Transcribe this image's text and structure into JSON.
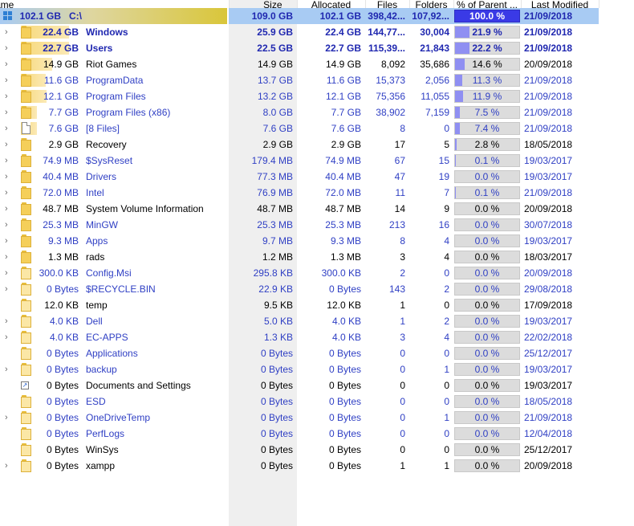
{
  "columns": {
    "name": "ame",
    "size": "Size",
    "allocated": "Allocated",
    "files": "Files",
    "folders": "Folders",
    "pct_parent": "% of Parent ...",
    "last_modified": "Last Modified"
  },
  "colors": {
    "root_row_bg": "#a8cbf3",
    "size_column_bg": "#efefef",
    "percent_bar": "#8f8ff2",
    "percent_bar_root": "#3a3ae6",
    "folder_yellow": "#f5cf5a",
    "bar_yellow": "#fbe9b6",
    "blue_text": "#2f3fc4"
  },
  "root": {
    "icon": "drive-icon",
    "tree_size": "102.1 GB",
    "name": "C:\\",
    "size": "109.0 GB",
    "allocated": "102.1 GB",
    "files": "398,42...",
    "folders": "107,92...",
    "pct": "100.0 %",
    "pct_value": 100,
    "modified": "21/09/2018"
  },
  "rows": [
    {
      "icon": "folder-icon",
      "expandable": true,
      "bar": 22.2,
      "style": "boldblue",
      "tree_size": "22.4 GB",
      "name": "Windows",
      "size": "25.9 GB",
      "allocated": "22.4 GB",
      "files": "144,77...",
      "folders": "30,004",
      "pct": "21.9 %",
      "pct_value": 21.9,
      "modified": "21/09/2018"
    },
    {
      "icon": "folder-icon",
      "expandable": true,
      "bar": 22.2,
      "style": "boldblue",
      "tree_size": "22.7 GB",
      "name": "Users",
      "size": "22.5 GB",
      "allocated": "22.7 GB",
      "files": "115,39...",
      "folders": "21,843",
      "pct": "22.2 %",
      "pct_value": 22.2,
      "modified": "21/09/2018"
    },
    {
      "icon": "folder-icon",
      "expandable": true,
      "bar": 14.6,
      "style": "black",
      "tree_size": "14.9 GB",
      "name": "Riot Games",
      "size": "14.9 GB",
      "allocated": "14.9 GB",
      "files": "8,092",
      "folders": "35,686",
      "pct": "14.6 %",
      "pct_value": 14.6,
      "modified": "20/09/2018"
    },
    {
      "icon": "folder-icon",
      "expandable": true,
      "bar": 11.3,
      "style": "blue",
      "tree_size": "11.6 GB",
      "name": "ProgramData",
      "size": "13.7 GB",
      "allocated": "11.6 GB",
      "files": "15,373",
      "folders": "2,056",
      "pct": "11.3 %",
      "pct_value": 11.3,
      "modified": "21/09/2018"
    },
    {
      "icon": "folder-icon",
      "expandable": true,
      "bar": 11.9,
      "style": "blue",
      "tree_size": "12.1 GB",
      "name": "Program Files",
      "size": "13.2 GB",
      "allocated": "12.1 GB",
      "files": "75,356",
      "folders": "11,055",
      "pct": "11.9 %",
      "pct_value": 11.9,
      "modified": "21/09/2018"
    },
    {
      "icon": "folder-icon",
      "expandable": true,
      "bar": 7.5,
      "style": "blue",
      "tree_size": "7.7 GB",
      "name": "Program Files (x86)",
      "size": "8.0 GB",
      "allocated": "7.7 GB",
      "files": "38,902",
      "folders": "7,159",
      "pct": "7.5 %",
      "pct_value": 7.5,
      "modified": "21/09/2018"
    },
    {
      "icon": "file-icon",
      "expandable": true,
      "bar": 7.4,
      "style": "blue",
      "tree_size": "7.6 GB",
      "name": "[8 Files]",
      "size": "7.6 GB",
      "allocated": "7.6 GB",
      "files": "8",
      "folders": "0",
      "pct": "7.4 %",
      "pct_value": 7.4,
      "modified": "21/09/2018"
    },
    {
      "icon": "folder-icon",
      "expandable": true,
      "bar": 2.8,
      "style": "black",
      "tree_size": "2.9 GB",
      "name": "Recovery",
      "size": "2.9 GB",
      "allocated": "2.9 GB",
      "files": "17",
      "folders": "5",
      "pct": "2.8 %",
      "pct_value": 2.8,
      "modified": "18/05/2018"
    },
    {
      "icon": "folder-icon",
      "expandable": true,
      "bar": 0.1,
      "style": "blue",
      "tree_size": "74.9 MB",
      "name": "$SysReset",
      "size": "179.4 MB",
      "allocated": "74.9 MB",
      "files": "67",
      "folders": "15",
      "pct": "0.1 %",
      "pct_value": 0.1,
      "modified": "19/03/2017"
    },
    {
      "icon": "folder-icon",
      "expandable": true,
      "bar": 0,
      "style": "blue",
      "tree_size": "40.4 MB",
      "name": "Drivers",
      "size": "77.3 MB",
      "allocated": "40.4 MB",
      "files": "47",
      "folders": "19",
      "pct": "0.0 %",
      "pct_value": 0,
      "modified": "19/03/2017"
    },
    {
      "icon": "folder-icon",
      "expandable": true,
      "bar": 0.1,
      "style": "blue",
      "tree_size": "72.0 MB",
      "name": "Intel",
      "size": "76.9 MB",
      "allocated": "72.0 MB",
      "files": "11",
      "folders": "7",
      "pct": "0.1 %",
      "pct_value": 0.1,
      "modified": "21/09/2018"
    },
    {
      "icon": "folder-icon",
      "expandable": true,
      "bar": 0,
      "style": "black",
      "tree_size": "48.7 MB",
      "name": "System Volume Information",
      "size": "48.7 MB",
      "allocated": "48.7 MB",
      "files": "14",
      "folders": "9",
      "pct": "0.0 %",
      "pct_value": 0,
      "modified": "20/09/2018"
    },
    {
      "icon": "folder-icon",
      "expandable": true,
      "bar": 0,
      "style": "blue",
      "tree_size": "25.3 MB",
      "name": "MinGW",
      "size": "25.3 MB",
      "allocated": "25.3 MB",
      "files": "213",
      "folders": "16",
      "pct": "0.0 %",
      "pct_value": 0,
      "modified": "30/07/2018"
    },
    {
      "icon": "folder-icon",
      "expandable": true,
      "bar": 0,
      "style": "blue",
      "tree_size": "9.3 MB",
      "name": "Apps",
      "size": "9.7 MB",
      "allocated": "9.3 MB",
      "files": "8",
      "folders": "4",
      "pct": "0.0 %",
      "pct_value": 0,
      "modified": "19/03/2017"
    },
    {
      "icon": "folder-icon",
      "expandable": true,
      "bar": 0,
      "style": "black",
      "tree_size": "1.3 MB",
      "name": "rads",
      "size": "1.2 MB",
      "allocated": "1.3 MB",
      "files": "3",
      "folders": "4",
      "pct": "0.0 %",
      "pct_value": 0,
      "modified": "18/03/2017"
    },
    {
      "icon": "folder-icon",
      "expandable": true,
      "bar": 0,
      "style": "blue",
      "tree_size": "300.0 KB",
      "name": "Config.Msi",
      "size": "295.8 KB",
      "allocated": "300.0 KB",
      "files": "2",
      "folders": "0",
      "pct": "0.0 %",
      "pct_value": 0,
      "modified": "20/09/2018"
    },
    {
      "icon": "folder-icon",
      "expandable": true,
      "bar": 0,
      "style": "blue",
      "tree_size": "0 Bytes",
      "name": "$RECYCLE.BIN",
      "size": "22.9 KB",
      "allocated": "0 Bytes",
      "files": "143",
      "folders": "2",
      "pct": "0.0 %",
      "pct_value": 0,
      "modified": "29/08/2018"
    },
    {
      "icon": "folder-icon",
      "expandable": false,
      "bar": 0,
      "style": "black",
      "tree_size": "12.0 KB",
      "name": "temp",
      "size": "9.5 KB",
      "allocated": "12.0 KB",
      "files": "1",
      "folders": "0",
      "pct": "0.0 %",
      "pct_value": 0,
      "modified": "17/09/2018"
    },
    {
      "icon": "folder-icon",
      "expandable": true,
      "bar": 0,
      "style": "blue",
      "tree_size": "4.0 KB",
      "name": "Dell",
      "size": "5.0 KB",
      "allocated": "4.0 KB",
      "files": "1",
      "folders": "2",
      "pct": "0.0 %",
      "pct_value": 0,
      "modified": "19/03/2017"
    },
    {
      "icon": "folder-icon",
      "expandable": true,
      "bar": 0,
      "style": "blue",
      "tree_size": "4.0 KB",
      "name": "EC-APPS",
      "size": "1.3 KB",
      "allocated": "4.0 KB",
      "files": "3",
      "folders": "4",
      "pct": "0.0 %",
      "pct_value": 0,
      "modified": "22/02/2018"
    },
    {
      "icon": "folder-icon",
      "expandable": false,
      "bar": 0,
      "style": "blue",
      "tree_size": "0 Bytes",
      "name": "Applications",
      "size": "0 Bytes",
      "allocated": "0 Bytes",
      "files": "0",
      "folders": "0",
      "pct": "0.0 %",
      "pct_value": 0,
      "modified": "25/12/2017"
    },
    {
      "icon": "folder-icon",
      "expandable": true,
      "bar": 0,
      "style": "blue",
      "tree_size": "0 Bytes",
      "name": "backup",
      "size": "0 Bytes",
      "allocated": "0 Bytes",
      "files": "0",
      "folders": "1",
      "pct": "0.0 %",
      "pct_value": 0,
      "modified": "19/03/2017"
    },
    {
      "icon": "shortcut-icon",
      "expandable": false,
      "bar": 0,
      "style": "black",
      "tree_size": "0 Bytes",
      "name": "Documents and Settings",
      "size": "0 Bytes",
      "allocated": "0 Bytes",
      "files": "0",
      "folders": "0",
      "pct": "0.0 %",
      "pct_value": 0,
      "modified": "19/03/2017"
    },
    {
      "icon": "folder-icon",
      "expandable": false,
      "bar": 0,
      "style": "blue",
      "tree_size": "0 Bytes",
      "name": "ESD",
      "size": "0 Bytes",
      "allocated": "0 Bytes",
      "files": "0",
      "folders": "0",
      "pct": "0.0 %",
      "pct_value": 0,
      "modified": "18/05/2018"
    },
    {
      "icon": "folder-icon",
      "expandable": true,
      "bar": 0,
      "style": "blue",
      "tree_size": "0 Bytes",
      "name": "OneDriveTemp",
      "size": "0 Bytes",
      "allocated": "0 Bytes",
      "files": "0",
      "folders": "1",
      "pct": "0.0 %",
      "pct_value": 0,
      "modified": "21/09/2018"
    },
    {
      "icon": "folder-icon",
      "expandable": false,
      "bar": 0,
      "style": "blue",
      "tree_size": "0 Bytes",
      "name": "PerfLogs",
      "size": "0 Bytes",
      "allocated": "0 Bytes",
      "files": "0",
      "folders": "0",
      "pct": "0.0 %",
      "pct_value": 0,
      "modified": "12/04/2018"
    },
    {
      "icon": "folder-icon",
      "expandable": false,
      "bar": 0,
      "style": "black",
      "tree_size": "0 Bytes",
      "name": "WinSys",
      "size": "0 Bytes",
      "allocated": "0 Bytes",
      "files": "0",
      "folders": "0",
      "pct": "0.0 %",
      "pct_value": 0,
      "modified": "25/12/2017"
    },
    {
      "icon": "folder-icon",
      "expandable": true,
      "bar": 0,
      "style": "black",
      "tree_size": "0 Bytes",
      "name": "xampp",
      "size": "0 Bytes",
      "allocated": "0 Bytes",
      "files": "1",
      "folders": "1",
      "pct": "0.0 %",
      "pct_value": 0,
      "modified": "20/09/2018"
    }
  ]
}
